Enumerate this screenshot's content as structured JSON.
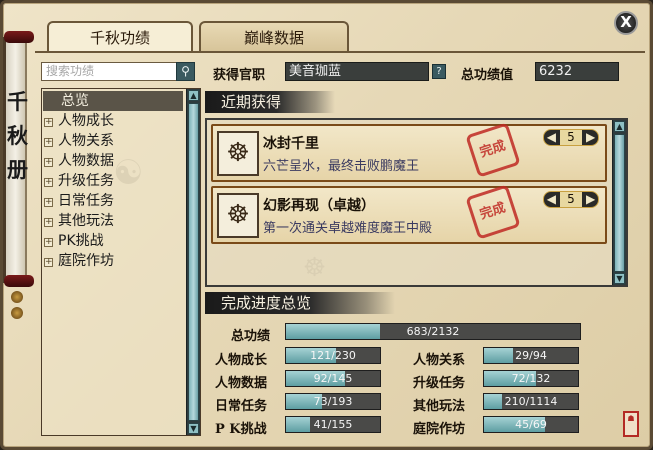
{
  "scroll_title": "千秋册",
  "close_label": "X",
  "tabs": [
    {
      "label": "千秋功绩",
      "active": true
    },
    {
      "label": "巅峰数据",
      "active": false
    }
  ],
  "search": {
    "placeholder": "搜索功绩",
    "button_icon": "search-icon"
  },
  "tree": {
    "items": [
      {
        "label": "总览",
        "selected": true,
        "expandable": false
      },
      {
        "label": "人物成长",
        "selected": false,
        "expandable": true
      },
      {
        "label": "人物关系",
        "selected": false,
        "expandable": true
      },
      {
        "label": "人物数据",
        "selected": false,
        "expandable": true
      },
      {
        "label": "升级任务",
        "selected": false,
        "expandable": true
      },
      {
        "label": "日常任务",
        "selected": false,
        "expandable": true
      },
      {
        "label": "其他玩法",
        "selected": false,
        "expandable": true
      },
      {
        "label": "PK挑战",
        "selected": false,
        "expandable": true
      },
      {
        "label": "庭院作坊",
        "selected": false,
        "expandable": true
      }
    ]
  },
  "header": {
    "title_label": "获得官职",
    "title_value": "美音珈蓝",
    "help_label": "?",
    "total_label": "总功绩值",
    "total_value": "6232"
  },
  "recent": {
    "banner": "近期获得",
    "cards": [
      {
        "title": "冰封千里",
        "desc": "六芒呈水，最终击败鹏魔王",
        "stamp": "完成",
        "points": "5"
      },
      {
        "title": "幻影再现（卓越）",
        "desc": "第一次通关卓越难度魔王中殿",
        "stamp": "完成",
        "points": "5"
      }
    ]
  },
  "progress": {
    "banner": "完成进度总览",
    "total": {
      "label": "总功绩",
      "text": "683/2132",
      "fraction": 0.32
    },
    "rows": [
      {
        "label": "人物成长",
        "text": "121/230",
        "fraction": 0.53
      },
      {
        "label": "人物关系",
        "text": "29/94",
        "fraction": 0.31
      },
      {
        "label": "人物数据",
        "text": "92/145",
        "fraction": 0.63
      },
      {
        "label": "升级任务",
        "text": "72/132",
        "fraction": 0.55
      },
      {
        "label": "日常任务",
        "text": "73/193",
        "fraction": 0.38
      },
      {
        "label": "其他玩法",
        "text": "210/1114",
        "fraction": 0.19
      },
      {
        "label": "P K挑战",
        "text": "41/155",
        "fraction": 0.26
      },
      {
        "label": "庭院作坊",
        "text": "45/69",
        "fraction": 0.65
      }
    ]
  },
  "colors": {
    "accent_fill": "#7cb2b6",
    "stamp_red": "#c02a24",
    "frame_brown": "#5a4a34"
  }
}
